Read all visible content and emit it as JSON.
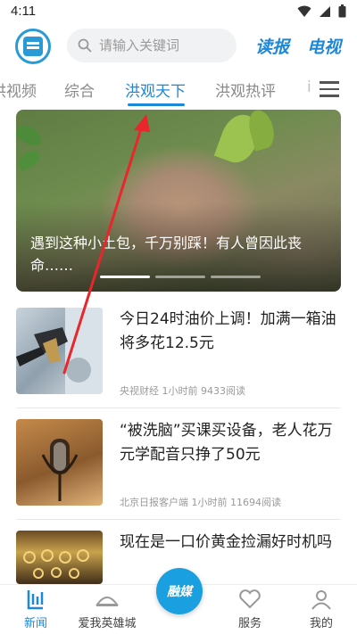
{
  "status_bar": {
    "time": "4:11"
  },
  "header": {
    "search_placeholder": "请输入关键词",
    "read_label": "读报",
    "tv_label": "电视"
  },
  "tabs": [
    {
      "label": "洪视频",
      "active": false
    },
    {
      "label": "综合",
      "active": false
    },
    {
      "label": "洪观天下",
      "active": true
    },
    {
      "label": "洪观热评",
      "active": false
    },
    {
      "label": "i",
      "active": false
    }
  ],
  "banner": {
    "title": "遇到这种小土包，千万别踩！有人曾因此丧命……",
    "slide_count": 3,
    "active_slide": 1
  },
  "news": [
    {
      "title": "今日24时油价上调！加满一箱油将多花12.5元",
      "meta": "央视财经 1小时前 9433阅读",
      "thumb": "fuel-nozzle"
    },
    {
      "title": "“被洗脑”买课买设备，老人花万元学配音只挣了50元",
      "meta": "北京日报客户端 1小时前 11694阅读",
      "thumb": "microphone"
    },
    {
      "title": "现在是一口价黄金捡漏好时机吗",
      "meta": "",
      "thumb": "gold-jewelry"
    }
  ],
  "bottom_nav": {
    "items": [
      {
        "label": "新闻",
        "active": true
      },
      {
        "label": "爱我英雄城",
        "active": false
      },
      {
        "label": "服务",
        "active": false
      },
      {
        "label": "我的",
        "active": false
      }
    ],
    "center_label": "融媒"
  },
  "colors": {
    "accent": "#1e88d8",
    "annotation": "#e8262b"
  }
}
